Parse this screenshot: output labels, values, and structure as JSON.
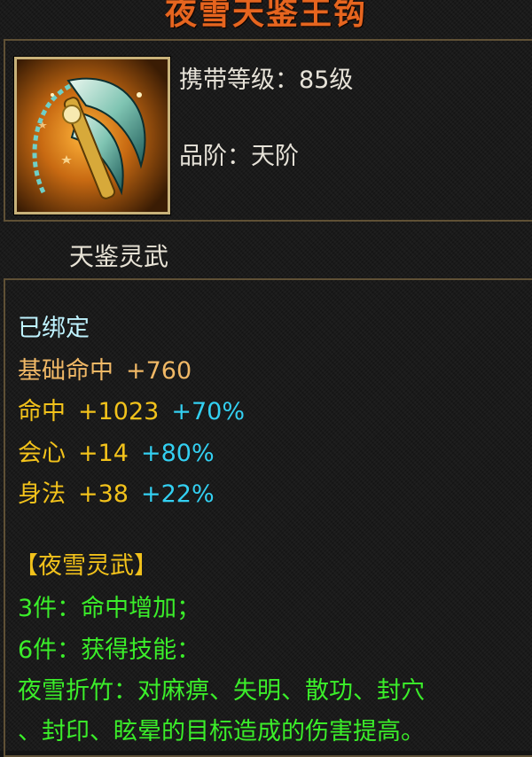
{
  "item": {
    "name": "夜雪天鉴王钩",
    "carry_level": "携带等级：85级",
    "grade": "品阶：天阶",
    "category": "天鉴灵武"
  },
  "status": {
    "bound": "已绑定"
  },
  "stats": [
    {
      "label": "基础命中",
      "value": "+760",
      "bonus": ""
    },
    {
      "label": "命中",
      "value": "+1023",
      "bonus": "+70%"
    },
    {
      "label": "会心",
      "value": "+14",
      "bonus": "+80%"
    },
    {
      "label": "身法",
      "value": "+38",
      "bonus": "+22%"
    }
  ],
  "set_bonus": {
    "name": "【夜雪灵武】",
    "piece3": "3件：命中增加；",
    "piece6": "6件：获得技能：",
    "skill_line1": "夜雪折竹：对麻痹、失明、散功、封穴",
    "skill_line2": "、封印、眩晕的目标造成的伤害提高。"
  },
  "colors": {
    "title": "#e6651f",
    "bound": "#bff3ff",
    "base_stat": "#f0b866",
    "stat": "#f2c21b",
    "bonus": "#33d0f2",
    "set": "#3bee2a",
    "frame": "#5f5035"
  },
  "icons": {
    "item_icon": "golden-hook-weapon-icon"
  }
}
